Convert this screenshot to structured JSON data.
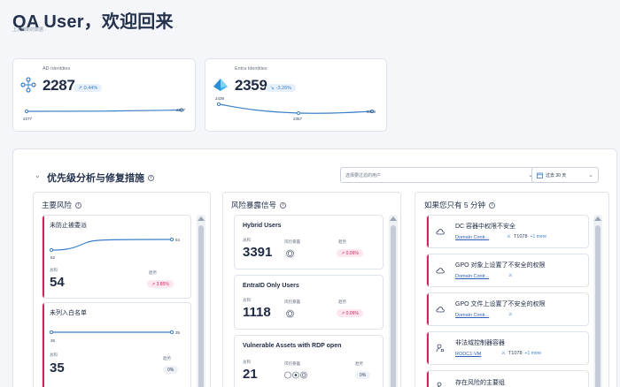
{
  "header": {
    "title": "QA User，欢迎回来",
    "subtitle": "上次刷新的数据 -"
  },
  "ad_card": {
    "label": "AD Identities",
    "value": "2287",
    "trend": "0.44%",
    "trend_dir": "up",
    "chart_start": "2277",
    "chart_end": "2287",
    "icon": "ad-network-icon"
  },
  "entra_card": {
    "label": "Entra Identities",
    "value": "2359",
    "trend": "-3.26%",
    "trend_dir": "down",
    "chart_start": "2439",
    "chart_min": "2357",
    "chart_end": "2359",
    "icon": "entra-pyramid-icon"
  },
  "main": {
    "title": "优先级分析与修复措施",
    "user_select_placeholder": "选择要过滤的用户",
    "date_select_label": "过去 30 天"
  },
  "risks_col": {
    "title": "主要风险",
    "cards": [
      {
        "title": "未防止被委派",
        "chart_start": "52",
        "chart_end": "54",
        "total_label": "总和",
        "total": "54",
        "trend_label": "趋势",
        "trend": "3.85%"
      },
      {
        "title": "未列入白名单",
        "chart_start": "35",
        "chart_end": "35",
        "total_label": "总和",
        "total": "35",
        "trend_label": "趋势",
        "trend": "0%"
      }
    ]
  },
  "exposure_col": {
    "title": "风险暴露信号",
    "cards": [
      {
        "title": "Hybrid Users",
        "total_label": "总和",
        "total": "3391",
        "exposure_label": "风险暴露",
        "trend_label": "趋势",
        "trend": "0.09%"
      },
      {
        "title": "EntraID Only Users",
        "total_label": "总和",
        "total": "1118",
        "exposure_label": "风险暴露",
        "trend_label": "趋势",
        "trend": "0.09%"
      },
      {
        "title": "Vulnerable Assets with RDP open",
        "total_label": "总和",
        "total": "21",
        "exposure_label": "风险暴露",
        "trend_label": "趋势",
        "trend": "0%"
      }
    ]
  },
  "five_min_col": {
    "title": "如果您只有 5 分钟",
    "items": [
      {
        "title": "DC 容器中权限不安全",
        "link": "Domain Contr...",
        "technique": "T1078",
        "more": "+1 more"
      },
      {
        "title": "GPO 对象上设置了不安全的权限",
        "link": "Domain Contr...",
        "technique": "",
        "more": ""
      },
      {
        "title": "GPO 文件上设置了不安全的权限",
        "link": "Domain Contr...",
        "technique": "",
        "more": ""
      },
      {
        "title": "非法域控制器容器",
        "link": "RODC1-VM",
        "technique": "T1078",
        "more": "+1 more"
      },
      {
        "title": "存在风险的主要组",
        "link": "",
        "technique": "",
        "more": ""
      }
    ]
  },
  "colors": {
    "accent": "#d1245b",
    "link": "#2d5fb8",
    "brand_blue": "#3c7fc9"
  }
}
